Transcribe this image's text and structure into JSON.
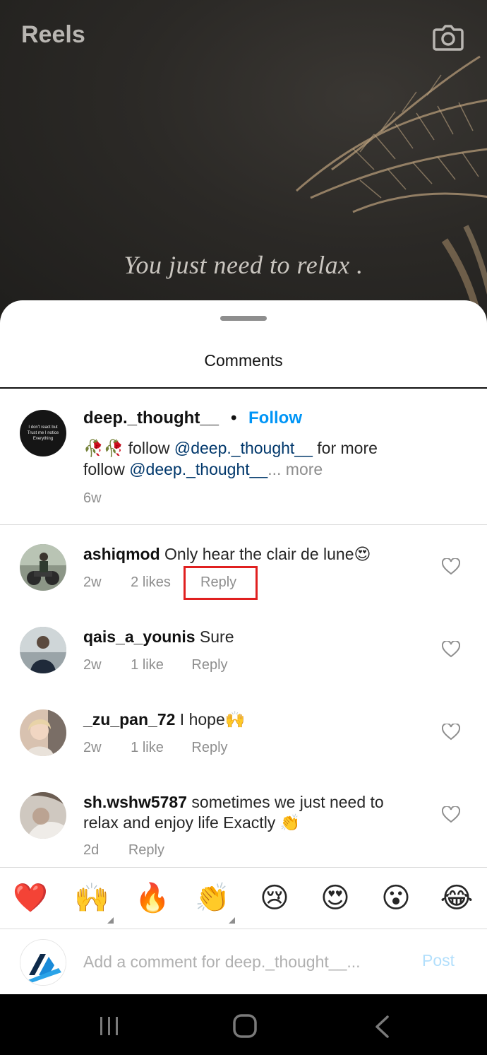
{
  "reel": {
    "title": "Reels",
    "caption_text": "You just need to relax ."
  },
  "sheet": {
    "title": "Comments"
  },
  "post": {
    "avatar_text": "I don't react but Trust me I notice Everything",
    "username": "deep._thought__",
    "separator": "•",
    "follow_label": "Follow",
    "line1_emoji": "🥀🥀",
    "line1_text": " follow ",
    "line1_mention": "@deep._thought__",
    "line1_tail": " for more",
    "line2_text": "follow ",
    "line2_mention": "@deep._thought__",
    "line2_more": "... more",
    "time": "6w"
  },
  "comments": [
    {
      "username": "ashiqmod",
      "text": " Only hear the clair de lune😍",
      "time": "2w",
      "likes": "2 likes",
      "reply": "Reply"
    },
    {
      "username": "qais_a_younis",
      "text": " Sure",
      "time": "2w",
      "likes": "1 like",
      "reply": "Reply"
    },
    {
      "username": "_zu_pan_72",
      "text": " I hope🙌",
      "time": "2w",
      "likes": "1 like",
      "reply": "Reply"
    },
    {
      "username": "sh.wshw5787",
      "text": " sometimes we just need to relax and enjoy life Exactly 👏",
      "time": "2d",
      "likes": "",
      "reply": "Reply"
    }
  ],
  "emoji_bar": [
    "❤️",
    "🙌",
    "🔥",
    "👏",
    "😢",
    "😍",
    "😮",
    "😂"
  ],
  "composer": {
    "placeholder": "Add a comment for deep._thought__...",
    "post_label": "Post"
  },
  "colors": {
    "accent": "#0095f6",
    "mention": "#00376b",
    "muted": "#8e8e8e",
    "highlight": "#e02020"
  }
}
